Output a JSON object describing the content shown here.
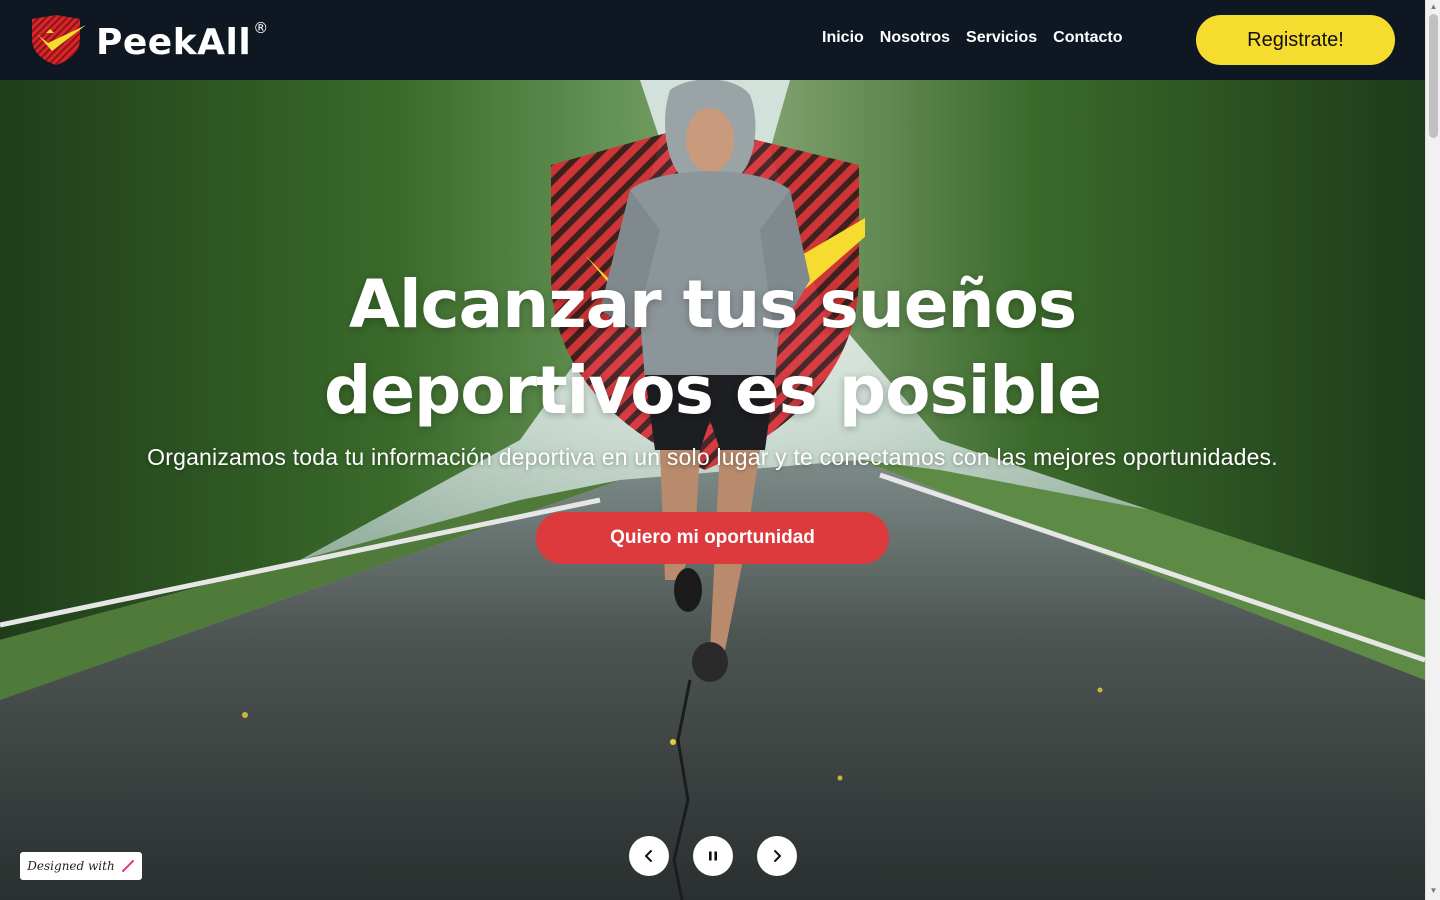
{
  "brand": {
    "name": "PeekAll",
    "reg_mark": "®"
  },
  "nav": {
    "items": [
      {
        "label": "Inicio"
      },
      {
        "label": "Nosotros"
      },
      {
        "label": "Servicios"
      },
      {
        "label": "Contacto"
      }
    ],
    "register_label": "Registrate!"
  },
  "hero": {
    "title_line1": "Alcanzar tus sueños",
    "title_line2": "deportivos es posible",
    "subtitle": "Organizamos toda tu información deportiva en un solo lugar y te conectamos con las mejores oportunidades.",
    "cta_label": "Quiero mi oportunidad"
  },
  "carousel": {
    "prev_icon": "chevron-left-icon",
    "pause_icon": "pause-icon",
    "next_icon": "chevron-right-icon"
  },
  "badge": {
    "text": "Designed with"
  },
  "colors": {
    "navbar": "#0f1722",
    "accent_yellow": "#f6dc2f",
    "cta_red": "#dc3a3d",
    "text_white": "#ffffff"
  }
}
